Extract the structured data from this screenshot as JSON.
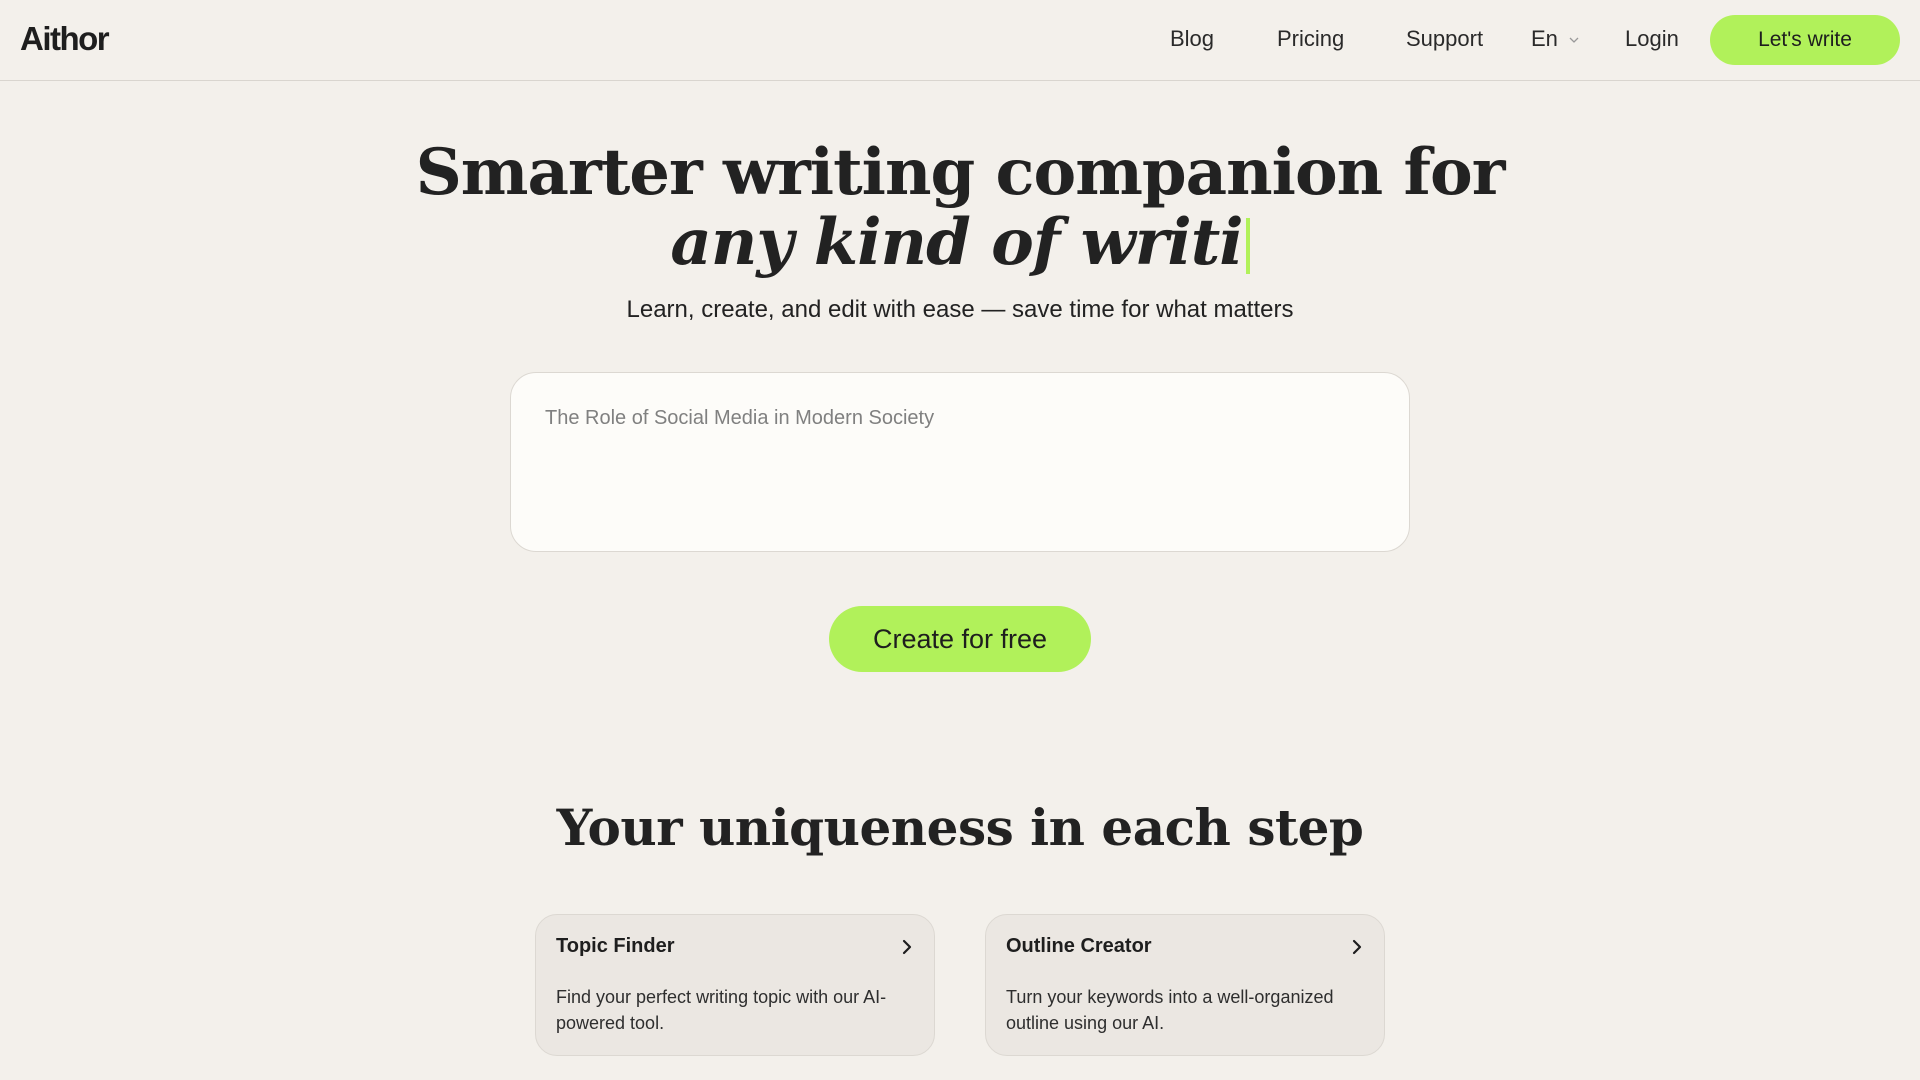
{
  "header": {
    "logo": "Aithor",
    "nav": {
      "blog": "Blog",
      "pricing": "Pricing",
      "support": "Support"
    },
    "language": "En",
    "login": "Login",
    "cta": "Let's write"
  },
  "hero": {
    "title_line1": "Smarter writing companion for",
    "title_line2": "any kind of writi",
    "subtitle": "Learn, create, and edit with ease — save time for what matters",
    "input_placeholder": "The Role of Social Media in Modern Society",
    "create_button": "Create for free"
  },
  "steps": {
    "title": "Your uniqueness in each step",
    "cards": [
      {
        "title": "Topic Finder",
        "description": "Find your perfect writing topic with our AI-powered tool."
      },
      {
        "title": "Outline Creator",
        "description": "Turn your keywords into a well-organized outline using our AI."
      }
    ]
  },
  "colors": {
    "background": "#f3f0eb",
    "accent": "#b1f15a",
    "card_background": "#ebe7e2"
  }
}
